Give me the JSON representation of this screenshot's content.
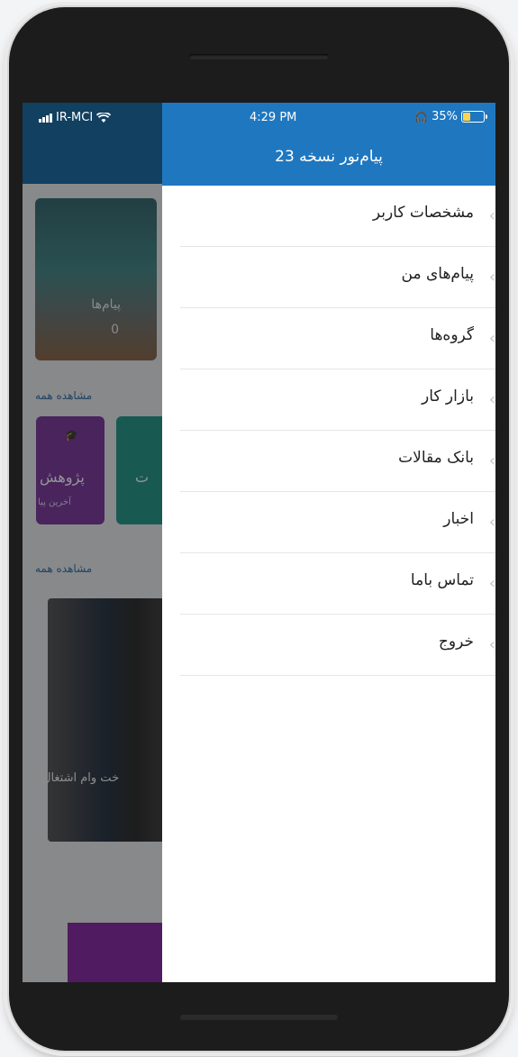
{
  "status": {
    "carrier": "IR-MCI",
    "time": "4:29 PM",
    "battery": "35%",
    "battery_level": 0.35
  },
  "drawer": {
    "title": "پیام‌نور نسخه 23",
    "items": [
      {
        "label": "مشخصات کاربر"
      },
      {
        "label": "پیام‌های من"
      },
      {
        "label": "گروه‌ها"
      },
      {
        "label": "بازار کار"
      },
      {
        "label": "بانک مقالات"
      },
      {
        "label": "اخبار"
      },
      {
        "label": "تماس باما"
      },
      {
        "label": "خروج"
      }
    ]
  },
  "background": {
    "messages_label": "پیام‌ها",
    "messages_count": "0",
    "see_all": "مشاهده همه",
    "research_tile": "پژوهش",
    "research_sub": "آخرین پیا",
    "teal_tile_fragment": "ت",
    "news_caption": "خت وام اشتغال"
  },
  "colors": {
    "header_blue": "#1f77c0",
    "purple": "#7e3fa0",
    "teal": "#2a9c8c"
  }
}
